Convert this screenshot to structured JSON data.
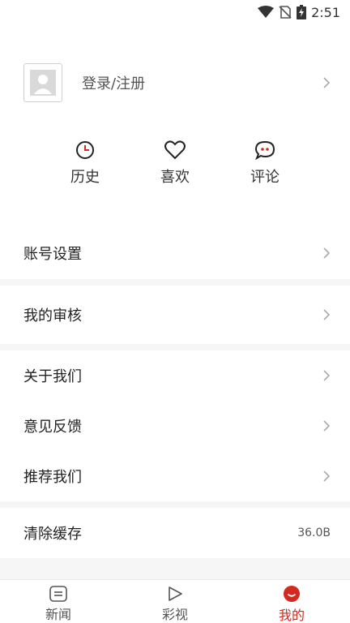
{
  "status_bar": {
    "time": "2:51"
  },
  "profile": {
    "login_label": "登录/注册"
  },
  "quick_actions": [
    {
      "label": "历史",
      "icon": "clock-icon"
    },
    {
      "label": "喜欢",
      "icon": "heart-icon"
    },
    {
      "label": "评论",
      "icon": "comment-icon"
    }
  ],
  "menu": {
    "account_settings": "账号设置",
    "my_review": "我的审核",
    "about_us": "关于我们",
    "feedback": "意见反馈",
    "recommend_us": "推荐我们",
    "clear_cache": "清除缓存",
    "cache_size": "36.0B"
  },
  "tabbar": {
    "news": "新闻",
    "video": "彩视",
    "mine": "我的"
  },
  "colors": {
    "accent": "#d22a1e",
    "separator": "#f6f6f6"
  }
}
